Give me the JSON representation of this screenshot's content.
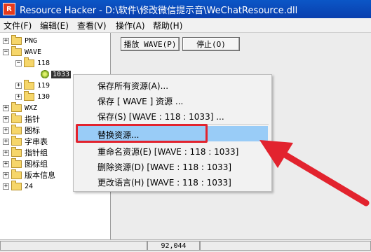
{
  "window": {
    "title": "Resource Hacker  -  D:\\软件\\修改微信提示音\\WeChatResource.dll",
    "icon": "resource-hacker-icon"
  },
  "menubar": [
    "文件(F)",
    "编辑(E)",
    "查看(V)",
    "操作(A)",
    "帮助(H)"
  ],
  "tree": {
    "png": "PNG",
    "wave": "WAVE",
    "n118": "118",
    "n1033": "1033",
    "n119": "119",
    "n130": "130",
    "wxz": "WXZ",
    "zhizhen": "指针",
    "tubiao": "图标",
    "zifuchuan": "字串表",
    "zhizhenzu": "指针组",
    "tubiaozu": "图标组",
    "banben": "版本信息",
    "n24": "24"
  },
  "toolbar": {
    "play": "播放 WAVE(P)",
    "stop": "停止(O)"
  },
  "context_menu": {
    "save_all": "保存所有资源(A)...",
    "save_wave": "保存 [ WAVE ] 资源 ...",
    "save_item": "保存(S) [WAVE : 118 : 1033] ...",
    "replace": "替换资源...",
    "rename": "重命名资源(E) [WAVE : 118 : 1033]",
    "delete": "删除资源(D) [WAVE : 118 : 1033]",
    "language": "更改语言(H) [WAVE : 118 : 1033]"
  },
  "status": {
    "size": "92,044"
  },
  "colors": {
    "title_bar": "#0a4ac0",
    "highlight": "#99ccf7",
    "annotation_red": "#e2232e"
  }
}
